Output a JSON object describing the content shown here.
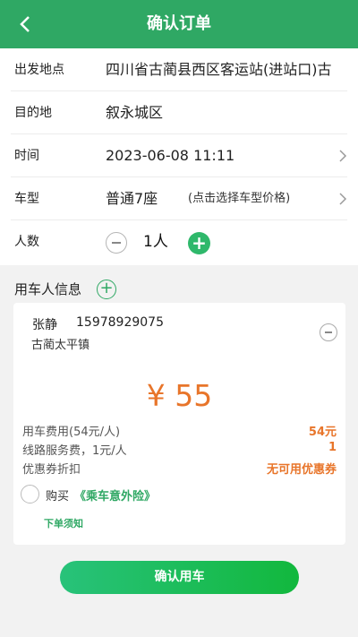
{
  "header": {
    "title": "确认订单",
    "back_icon": "chevron-left-icon"
  },
  "form": {
    "departure": {
      "label": "出发地点",
      "value": "四川省古蔺县西区客运站(进站口)古"
    },
    "destination": {
      "label": "目的地",
      "value": "叙永城区"
    },
    "time": {
      "label": "时间",
      "value": "2023-06-08 11:11"
    },
    "vehicle": {
      "label": "车型",
      "value": "普通7座",
      "hint": "(点击选择车型价格)"
    },
    "people": {
      "label": "人数",
      "count": "1人"
    }
  },
  "passengers": {
    "title": "用车人信息",
    "list": [
      {
        "name": "张静",
        "phone": "15978929075",
        "address": "古蔺太平镇"
      }
    ]
  },
  "fees": {
    "total": "¥ 55",
    "items": [
      {
        "label": "用车费用(54元/人)",
        "value": "54元"
      },
      {
        "label": "线路服务费，1元/人",
        "value": "1"
      },
      {
        "label": "优惠券折扣",
        "value": "无可用优惠券"
      }
    ]
  },
  "insurance": {
    "prefix": "购买",
    "link": "《乘车意外险》",
    "checked": false
  },
  "notice": "下单须知",
  "confirm_button": "确认用车",
  "colors": {
    "brand": "#2fa864",
    "accent": "#e8752a"
  }
}
